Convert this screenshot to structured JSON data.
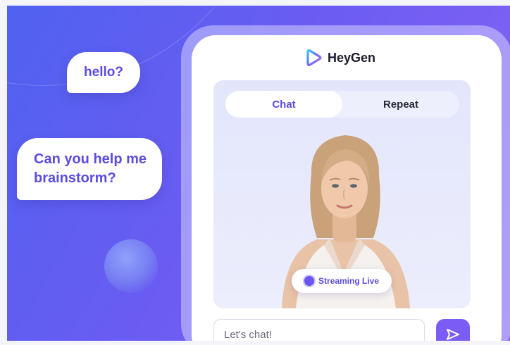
{
  "bubbles": {
    "first": "hello?",
    "second_line1": "Can you help me",
    "second_line2": "brainstorm?"
  },
  "app": {
    "brand_name": "HeyGen"
  },
  "tabs": [
    {
      "label": "Chat",
      "active": true
    },
    {
      "label": "Repeat",
      "active": false
    }
  ],
  "status": {
    "live_label": "Streaming Live"
  },
  "composer": {
    "placeholder": "Let's chat!"
  },
  "icons": {
    "logo": "heygen-logo-icon",
    "send": "send-icon",
    "live": "live-dot-icon"
  },
  "colors": {
    "accent": "#5b4ce0",
    "send_button": "#7b5cf5",
    "background_start": "#4f62f0",
    "background_end": "#8a63f4"
  }
}
